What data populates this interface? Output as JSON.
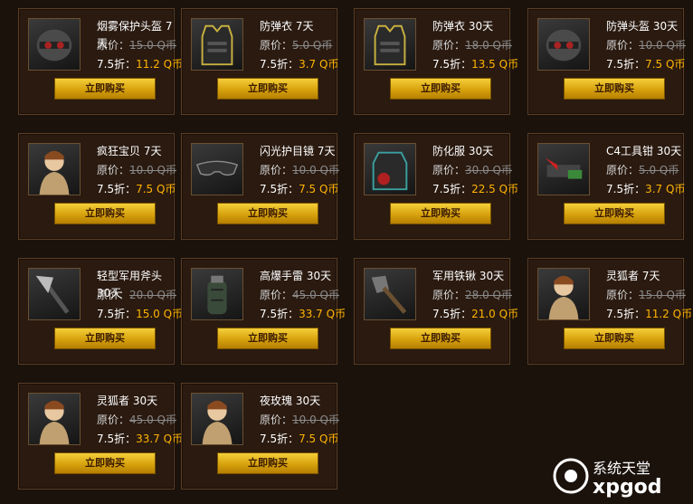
{
  "labels": {
    "original_prefix": "原价：",
    "discount_prefix": "7.5折：",
    "buy_button": "立即购买"
  },
  "items": [
    {
      "name": "烟雾保护头盔 7天",
      "original": "15.0 Q币",
      "discount": "11.2 Q币",
      "icon": "helmet-icon"
    },
    {
      "name": "防弹衣 7天",
      "original": "5.0 Q币",
      "discount": "3.7 Q币",
      "icon": "vest-icon"
    },
    {
      "name": "防弹衣 30天",
      "original": "18.0 Q币",
      "discount": "13.5 Q币",
      "icon": "vest-icon"
    },
    {
      "name": "防弹头盔 30天",
      "original": "10.0 Q币",
      "discount": "7.5 Q币",
      "icon": "helmet-icon"
    },
    {
      "name": "疯狂宝贝 7天",
      "original": "10.0 Q币",
      "discount": "7.5 Q币",
      "icon": "character-icon"
    },
    {
      "name": "闪光护目镜 7天",
      "original": "10.0 Q币",
      "discount": "7.5 Q币",
      "icon": "goggles-icon"
    },
    {
      "name": "防化服 30天",
      "original": "30.0 Q币",
      "discount": "22.5 Q币",
      "icon": "hazmat-icon"
    },
    {
      "name": "C4工具钳 30天",
      "original": "5.0 Q币",
      "discount": "3.7 Q币",
      "icon": "pliers-icon"
    },
    {
      "name": "轻型军用斧头 30天",
      "original": "20.0 Q币",
      "discount": "15.0 Q币",
      "icon": "axe-icon"
    },
    {
      "name": "高爆手雷 30天",
      "original": "45.0 Q币",
      "discount": "33.7 Q币",
      "icon": "grenade-icon"
    },
    {
      "name": "军用铁锹 30天",
      "original": "28.0 Q币",
      "discount": "21.0 Q币",
      "icon": "shovel-icon"
    },
    {
      "name": "灵狐者 7天",
      "original": "15.0 Q币",
      "discount": "11.2 Q币",
      "icon": "character-icon"
    },
    {
      "name": "灵狐者 30天",
      "original": "45.0 Q币",
      "discount": "33.7 Q币",
      "icon": "character-icon"
    },
    {
      "name": "夜玫瑰 30天",
      "original": "10.0 Q币",
      "discount": "7.5 Q币",
      "icon": "character-icon"
    }
  ],
  "watermark": {
    "line1": "系统天堂",
    "line2": "xpgod"
  }
}
